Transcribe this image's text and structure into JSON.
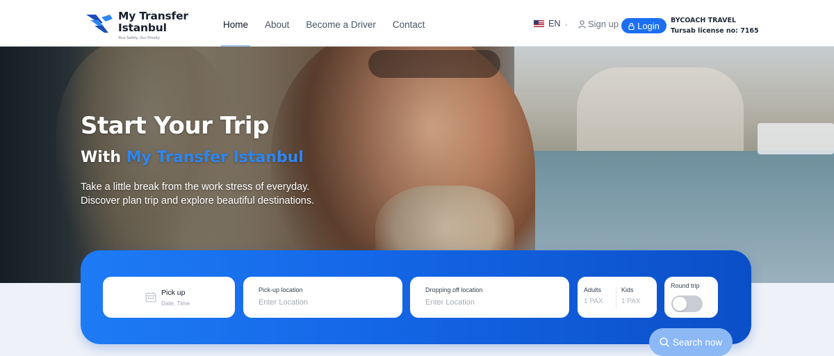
{
  "brand": {
    "name_line1": "My Transfer",
    "name_line2": "Istanbul",
    "tagline": "Your Safety, Our Priority"
  },
  "nav": {
    "items": [
      {
        "label": "Home",
        "active": true
      },
      {
        "label": "About",
        "active": false
      },
      {
        "label": "Become a Driver",
        "active": false
      },
      {
        "label": "Contact",
        "active": false
      }
    ]
  },
  "header_right": {
    "language": "EN",
    "signup_label": "Sign up",
    "login_label": "Login",
    "company_name": "BYCOACH TRAVEL",
    "license": "Tursab license no: 7165"
  },
  "hero": {
    "title": "Start Your Trip",
    "subtitle_prefix": "With ",
    "subtitle_brand": "My Transfer Istanbul",
    "description_line1": "Take a little break from the work stress of everyday.",
    "description_line2": "Discover plan trip and explore beautiful destinations."
  },
  "search": {
    "pickup_label": "Pick up",
    "pickup_sub": "Date, Time",
    "pickup_location_label": "Pick-up location",
    "pickup_location_placeholder": "Enter Location",
    "dropoff_location_label": "Dropping off location",
    "dropoff_location_placeholder": "Enter Location",
    "adults_label": "Adults",
    "adults_value": "1 PAX",
    "kids_label": "Kids",
    "kids_value": "1 PAX",
    "round_trip_label": "Round trip",
    "round_trip_on": false,
    "button_label": "Search now"
  },
  "colors": {
    "primary": "#1d6ff2",
    "brand_text": "#2f86f0",
    "panel_dark": "#0b4fc7"
  }
}
